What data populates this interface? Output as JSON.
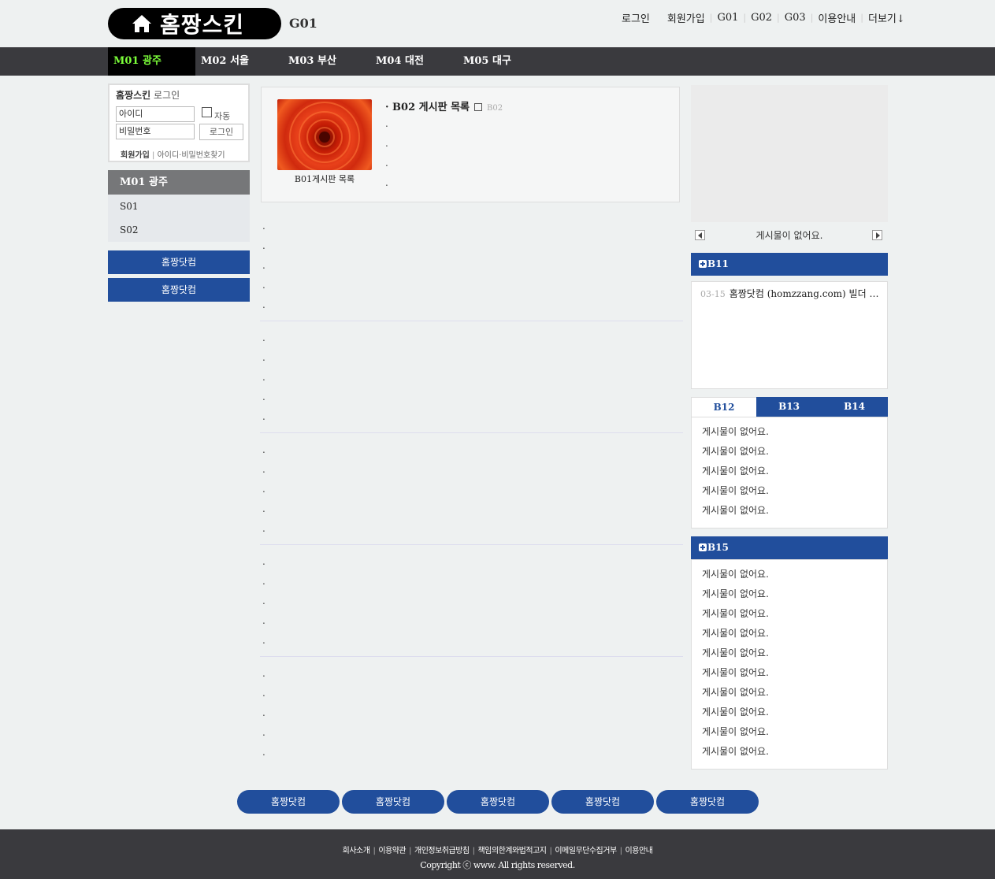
{
  "header": {
    "logo_text": "홈짱스킨",
    "site_code": "G01",
    "topnav": [
      "로그인",
      "회원가입",
      "G01",
      "G02",
      "G03",
      "이용안내",
      "더보기↓"
    ]
  },
  "mainnav": [
    {
      "label": "M01 광주",
      "active": true
    },
    {
      "label": "M02 서울"
    },
    {
      "label": "M03 부산"
    },
    {
      "label": "M04 대전"
    },
    {
      "label": "M05 대구"
    }
  ],
  "login": {
    "title_bold": "홈짱스킨",
    "title_rest": " 로그인",
    "id_placeholder": "아이디",
    "pw_placeholder": "비밀번호",
    "auto_label": "자동",
    "login_button": "로그인",
    "join_link": "회원가입",
    "find_link": "아이디·비밀번호찾기"
  },
  "leftmenu": {
    "head": "M01 광주",
    "items": [
      "S01",
      "S02"
    ],
    "buttons": [
      "홈짱닷컴",
      "홈짱닷컴"
    ]
  },
  "featured": {
    "thumb_caption": "B01게시판 목록",
    "board_title_prefix": "· B02",
    "board_title": " 게시판 목록",
    "board_tag": "B02",
    "dots": [
      ".",
      ".",
      ".",
      "."
    ]
  },
  "center_groups": [
    ".",
    ".",
    ".",
    ".",
    "."
  ],
  "right": {
    "slider_msg": "게시물이 없어요.",
    "b11": {
      "title": "B11",
      "date": "03-15",
      "text": "홈짱닷컴 (homzzang.com) 빌더 …"
    },
    "tabs": [
      {
        "label": "B12",
        "active": true
      },
      {
        "label": "B13"
      },
      {
        "label": "B14"
      }
    ],
    "tab_rows": [
      "게시물이 없어요.",
      "게시물이 없어요.",
      "게시물이 없어요.",
      "게시물이 없어요.",
      "게시물이 없어요."
    ],
    "b15": {
      "title": "B15",
      "rows": [
        "게시물이 없어요.",
        "게시물이 없어요.",
        "게시물이 없어요.",
        "게시물이 없어요.",
        "게시물이 없어요.",
        "게시물이 없어요.",
        "게시물이 없어요.",
        "게시물이 없어요.",
        "게시물이 없어요.",
        "게시물이 없어요."
      ]
    }
  },
  "bottom_buttons": [
    "홈짱닷컴",
    "홈짱닷컴",
    "홈짱닷컴",
    "홈짱닷컴",
    "홈짱닷컴"
  ],
  "footer": {
    "links": [
      "회사소개",
      "이용약관",
      "개인정보취급방침",
      "책임의한계와법적고지",
      "이메일무단수집거부",
      "이용안내"
    ],
    "copyright": "Copyright ⓒ www. All rights reserved."
  },
  "colors": {
    "accent_blue": "#214e9c",
    "nav_bg": "#3a3a3e",
    "nav_active_text": "#7cff3a"
  }
}
